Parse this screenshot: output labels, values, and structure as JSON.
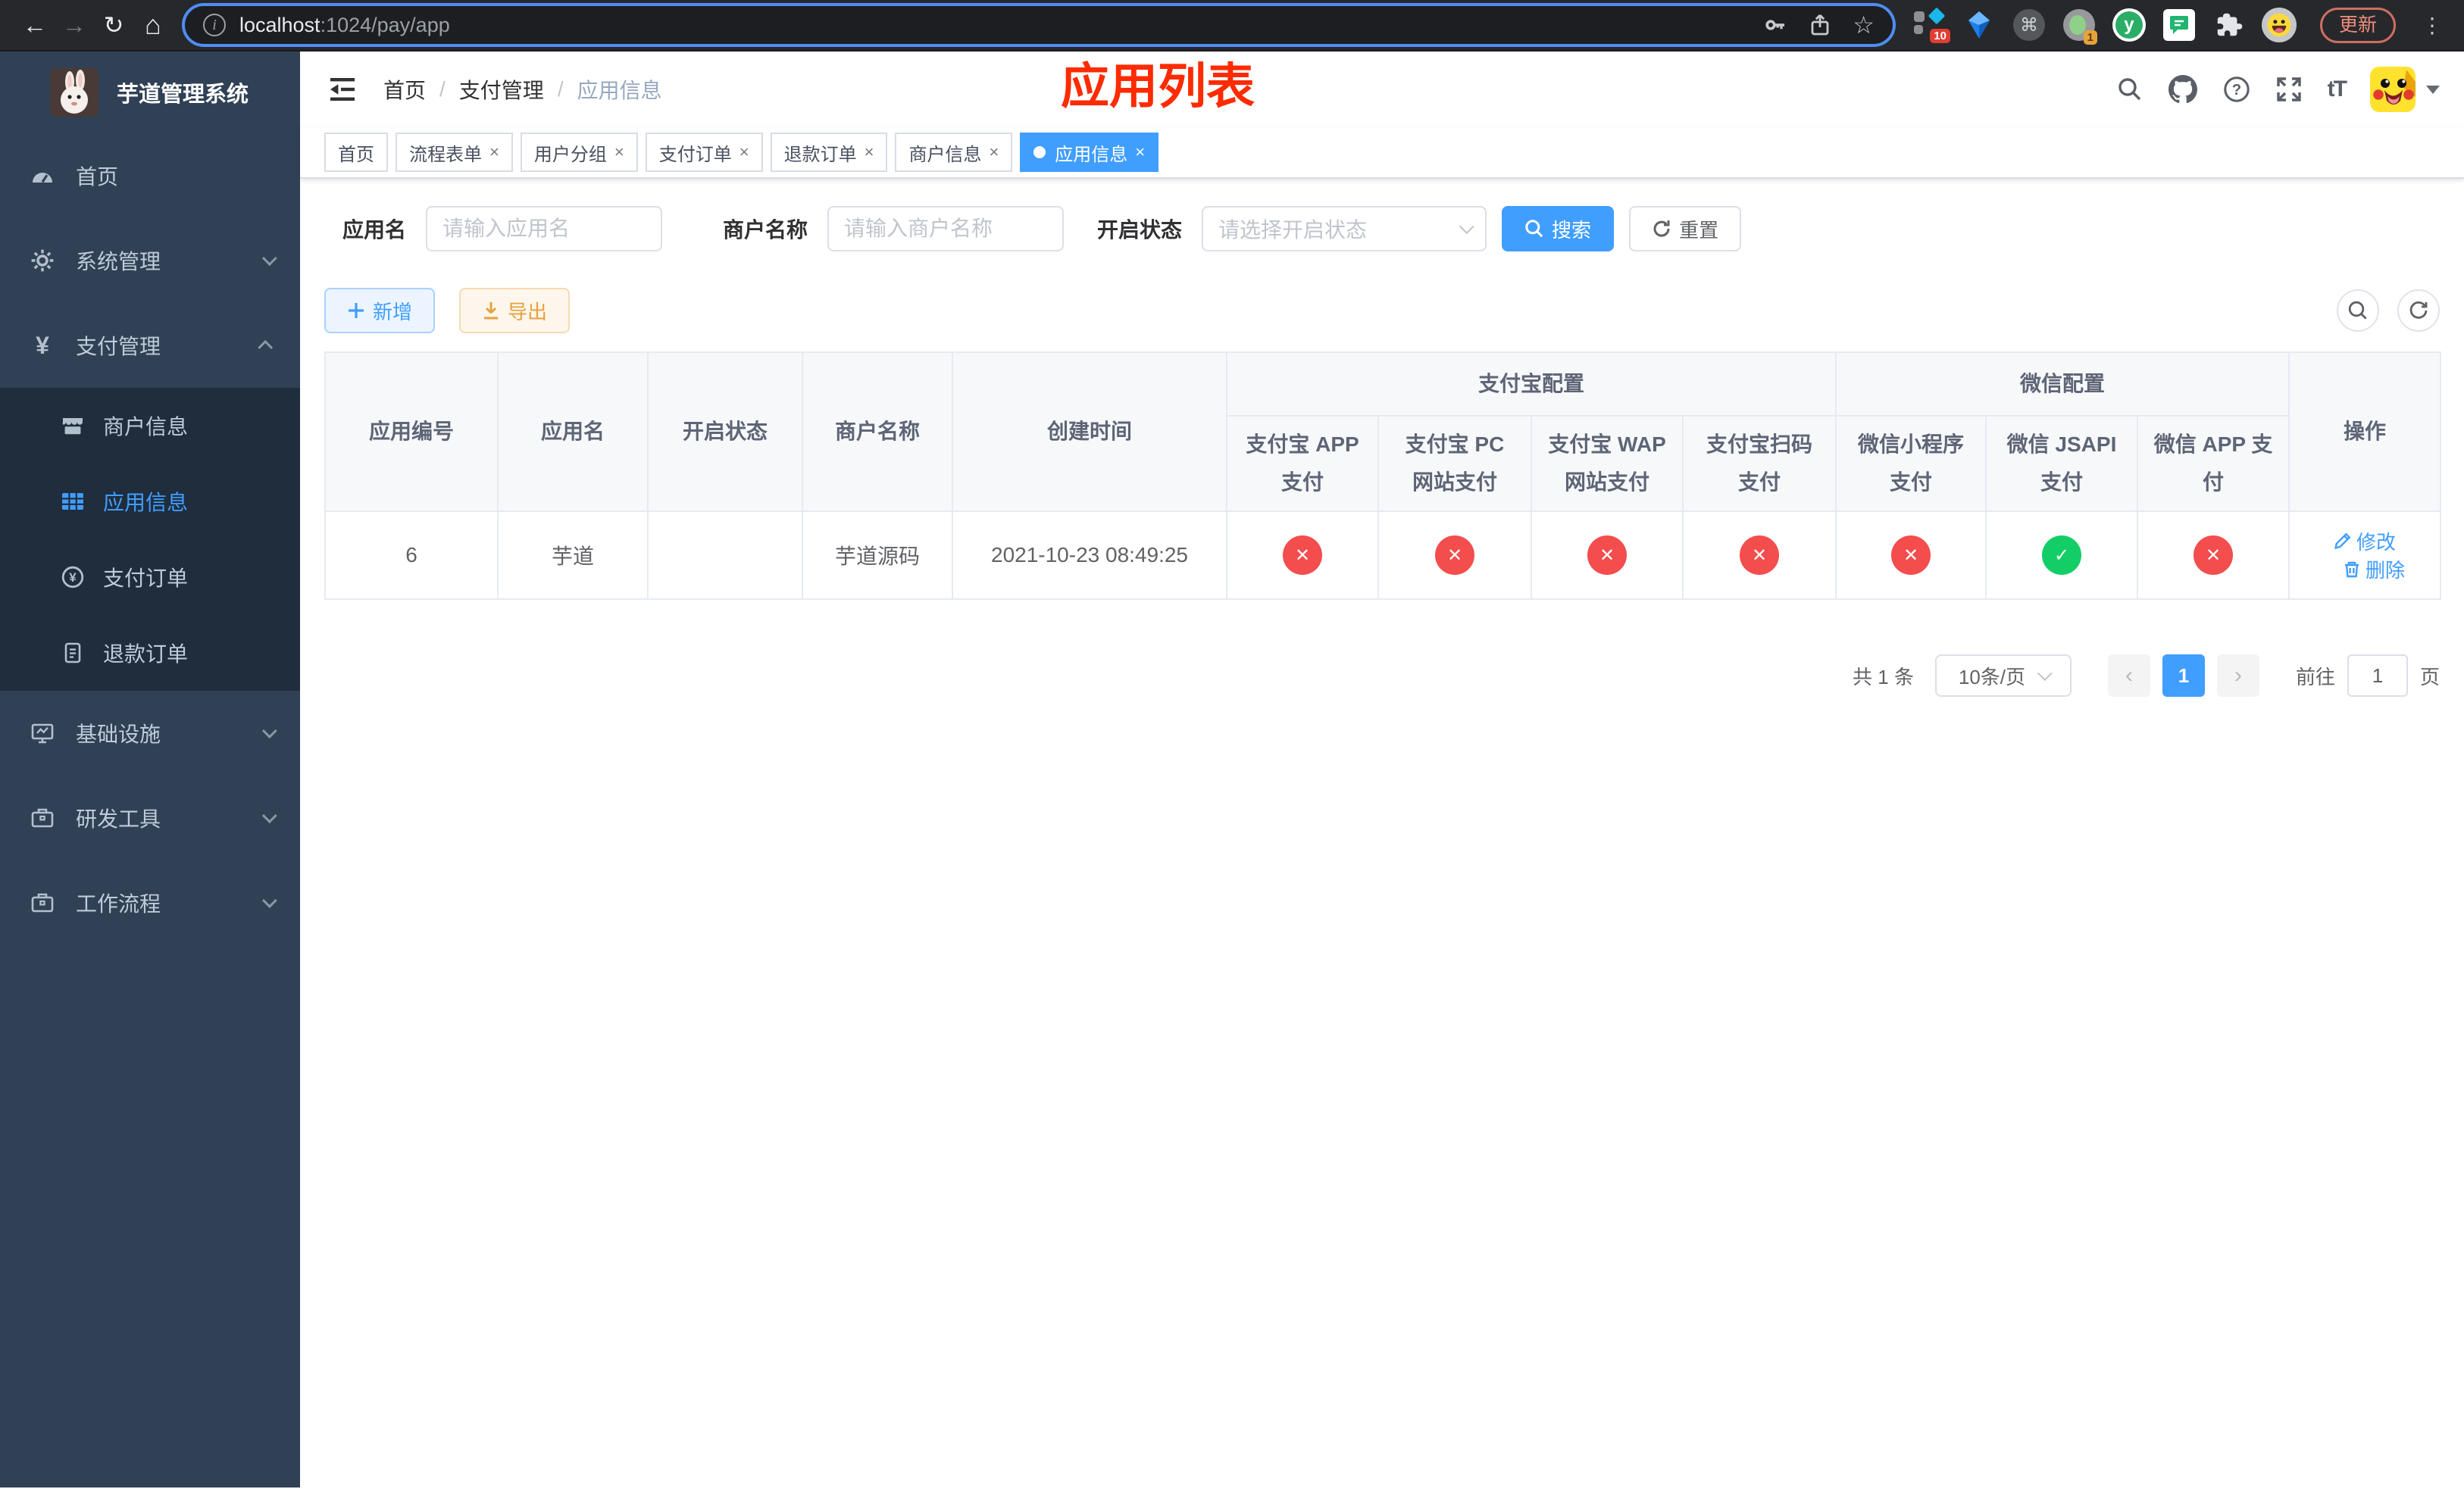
{
  "colors": {
    "primary": "#409eff",
    "success": "#13ce66",
    "danger": "#f34d4d",
    "warning": "#e6a23c",
    "sidebar_bg": "#304156",
    "annotation": "#fe2b00"
  },
  "glyphs": {
    "back": "←",
    "forward": "→",
    "reload": "↻",
    "home": "⌂",
    "info": "i",
    "star": "☆",
    "command": "⌘",
    "kebab": "⋮",
    "close": "×",
    "slash": "/",
    "prev": "‹",
    "next": "›",
    "check": "✓",
    "cross": "✕",
    "plus": "＋",
    "yuque": "y",
    "font_size": "tT"
  },
  "browser": {
    "url": {
      "host": "localhost",
      "path": ":1024/pay/app"
    },
    "ext_badge_tabs": "10",
    "ext_badge_one": "1",
    "update_button": "更新"
  },
  "sidebar": {
    "title": "芋道管理系统",
    "menu": {
      "home": "首页",
      "system": "系统管理",
      "payment": "支付管理",
      "merchant_info": "商户信息",
      "app_info": "应用信息",
      "pay_order": "支付订单",
      "refund_order": "退款订单",
      "infra": "基础设施",
      "dev_tools": "研发工具",
      "workflow": "工作流程"
    }
  },
  "topbar": {
    "breadcrumb": {
      "home": "首页",
      "section": "支付管理",
      "current": "应用信息"
    },
    "annotation": "应用列表"
  },
  "tabs": {
    "items": [
      {
        "label": "首页",
        "closable": false,
        "active": false
      },
      {
        "label": "流程表单",
        "closable": true,
        "active": false
      },
      {
        "label": "用户分组",
        "closable": true,
        "active": false
      },
      {
        "label": "支付订单",
        "closable": true,
        "active": false
      },
      {
        "label": "退款订单",
        "closable": true,
        "active": false
      },
      {
        "label": "商户信息",
        "closable": true,
        "active": false
      },
      {
        "label": "应用信息",
        "closable": true,
        "active": true
      }
    ]
  },
  "filters": {
    "app_name_label": "应用名",
    "app_name_placeholder": "请输入应用名",
    "merchant_label": "商户名称",
    "merchant_placeholder": "请输入商户名称",
    "status_label": "开启状态",
    "status_placeholder": "请选择开启状态",
    "search": "搜索",
    "reset": "重置"
  },
  "toolbar": {
    "add": "新增",
    "export": "导出"
  },
  "table": {
    "columns": {
      "id": "应用编号",
      "name": "应用名",
      "enabled": "开启状态",
      "merchant": "商户名称",
      "created": "创建时间",
      "alipay_group": "支付宝配置",
      "wechat_group": "微信配置",
      "alipay_app": "支付宝 APP 支付",
      "alipay_pc": "支付宝 PC 网站支付",
      "alipay_wap": "支付宝 WAP 网站支付",
      "alipay_qr": "支付宝扫码支付",
      "wx_lite": "微信小程序支付",
      "wx_jsapi": "微信 JSAPI 支付",
      "wx_app": "微信 APP 支付",
      "actions": "操作"
    },
    "rows": [
      {
        "id": "6",
        "name": "芋道",
        "enabled": true,
        "merchant": "芋道源码",
        "created": "2021-10-23 08:49:25",
        "statuses": [
          false,
          false,
          false,
          false,
          false,
          true,
          false
        ],
        "edit": "修改",
        "delete": "删除"
      }
    ]
  },
  "pagination": {
    "total": "共 1 条",
    "page_size": "10条/页",
    "page": "1",
    "goto_label": "前往",
    "goto_value": "1",
    "goto_unit": "页"
  }
}
